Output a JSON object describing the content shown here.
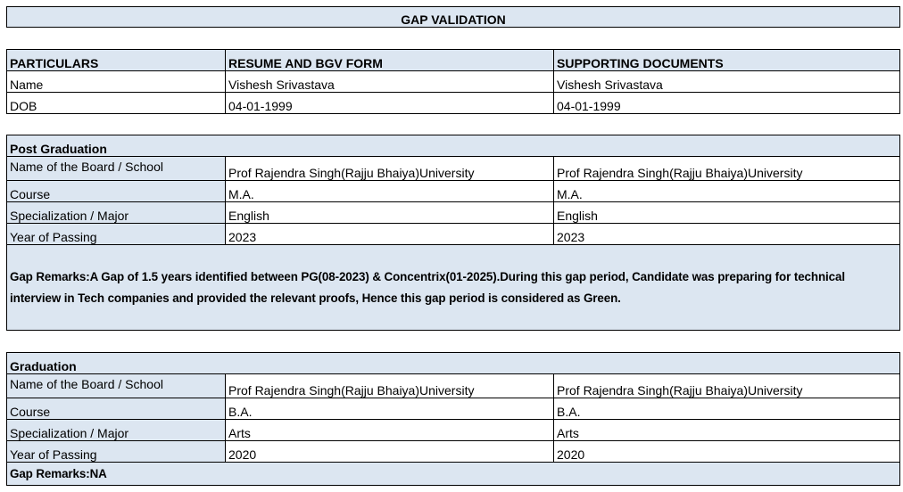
{
  "title": "GAP VALIDATION",
  "particulars": {
    "headers": [
      "PARTICULARS",
      "RESUME AND BGV FORM",
      "SUPPORTING DOCUMENTS"
    ],
    "rows": [
      [
        "Name",
        "Vishesh Srivastava",
        "Vishesh Srivastava"
      ],
      [
        "DOB",
        "04-01-1999",
        "04-01-1999"
      ]
    ]
  },
  "post_graduation": {
    "heading": "Post Graduation",
    "rows": [
      [
        "Name of the Board / School",
        "Prof Rajendra Singh(Rajju Bhaiya)University",
        "Prof Rajendra Singh(Rajju Bhaiya)University"
      ],
      [
        "Course",
        "M.A.",
        "M.A."
      ],
      [
        "Specialization / Major",
        "English",
        "English"
      ],
      [
        "Year of Passing",
        "2023",
        "2023"
      ]
    ],
    "remarks": "Gap Remarks:A Gap of 1.5 years identified between PG(08-2023) & Concentrix(01-2025).During this gap period, Candidate was preparing for technical interview in Tech companies and provided the relevant proofs, Hence this gap period is considered as Green."
  },
  "graduation": {
    "heading": "Graduation",
    "rows": [
      [
        "Name of the Board / School",
        "Prof Rajendra Singh(Rajju Bhaiya)University",
        "Prof Rajendra Singh(Rajju Bhaiya)University"
      ],
      [
        "Course",
        "B.A.",
        "B.A."
      ],
      [
        "Specialization / Major",
        "Arts",
        "Arts"
      ],
      [
        "Year of Passing",
        "2020",
        "2020"
      ]
    ],
    "remarks": "Gap Remarks:NA"
  }
}
